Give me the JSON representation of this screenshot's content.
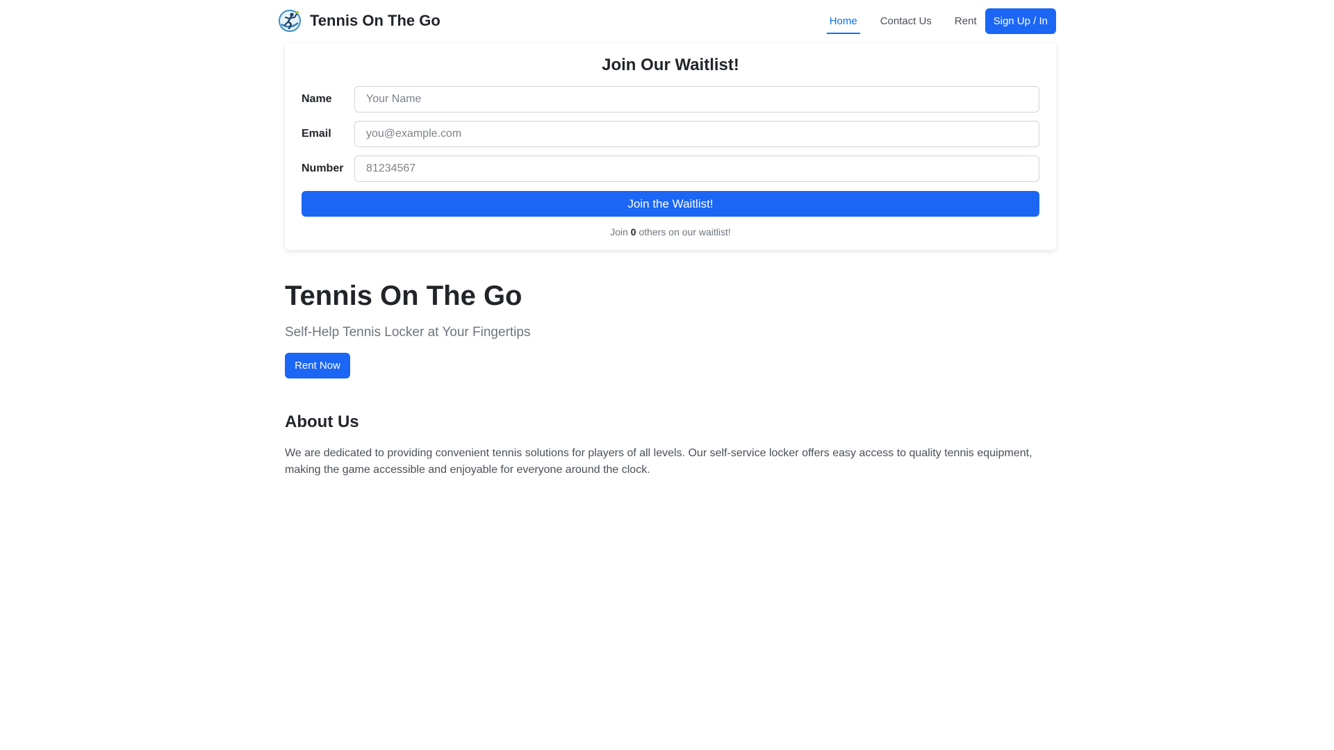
{
  "navbar": {
    "brand": "Tennis On The Go",
    "logo_icon": "tennis-player-icon",
    "links": [
      {
        "label": "Home",
        "active": true
      },
      {
        "label": "Contact Us",
        "active": false
      },
      {
        "label": "Rent",
        "active": false
      }
    ],
    "signup_label": "Sign Up / In"
  },
  "waitlist": {
    "title": "Join Our Waitlist!",
    "fields": [
      {
        "label": "Name",
        "value": "",
        "placeholder": "Your Name"
      },
      {
        "label": "Email",
        "value": "",
        "placeholder": "you@example.com"
      },
      {
        "label": "Number",
        "value": "",
        "placeholder": "81234567"
      }
    ],
    "submit_label": "Join the Waitlist!",
    "note_prefix": "Join",
    "count": "0",
    "note_suffix": "others on our waitlist!"
  },
  "hero": {
    "title": "Tennis On The Go",
    "subtitle": "Self-Help Tennis Locker at Your Fingertips",
    "cta_label": "Rent Now"
  },
  "about": {
    "title": "About Us",
    "text": "We are dedicated to providing convenient tennis solutions for players of all levels. Our self-service locker offers easy access to quality tennis equipment, making the game accessible and enjoyable for everyone around the clock."
  },
  "colors": {
    "primary": "#1b66f5",
    "link_active": "#0d6efd",
    "muted_text": "#6c757d"
  }
}
